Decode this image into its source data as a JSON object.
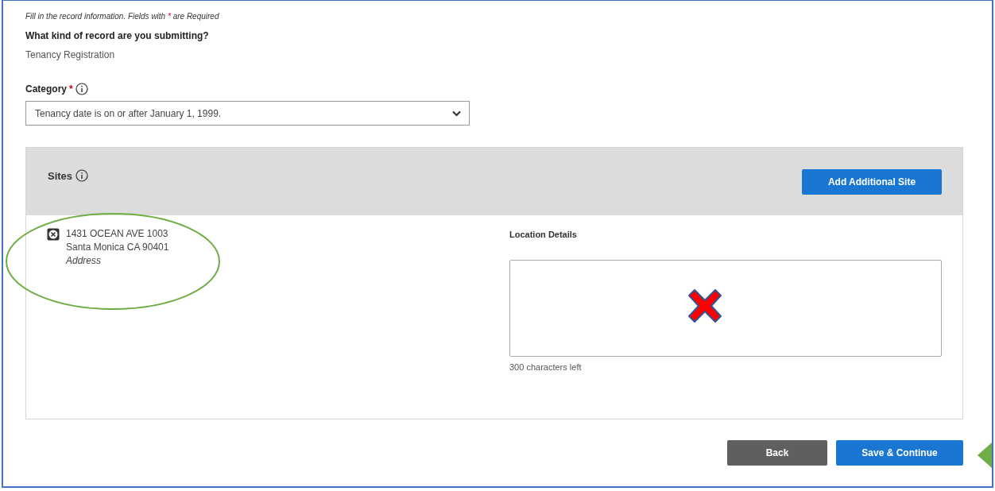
{
  "intro": {
    "before": "Fill in the record information. Fields with",
    "mark": "*",
    "after": "are Required"
  },
  "record_question": {
    "label": "What kind of record are you submitting?",
    "value": "Tenancy Registration"
  },
  "category": {
    "label": "Category",
    "required_mark": "*",
    "value": "Tenancy date is on or after January 1, 1999."
  },
  "sites": {
    "title": "Sites",
    "add_button": "Add Additional Site",
    "items": [
      {
        "line_1": "1431 OCEAN AVE 1003",
        "line_2": "Santa Monica CA 90401",
        "type": "Address"
      }
    ],
    "location_details": {
      "label": "Location Details",
      "counter": "300 characters left"
    }
  },
  "annotations": [
    {
      "kind": "ellipse"
    },
    {
      "kind": "cross"
    },
    {
      "kind": "arrow"
    }
  ],
  "buttons": [
    {
      "label": "Back",
      "kind": "secondary"
    },
    {
      "label": "Save & Continue",
      "kind": "primary"
    }
  ]
}
